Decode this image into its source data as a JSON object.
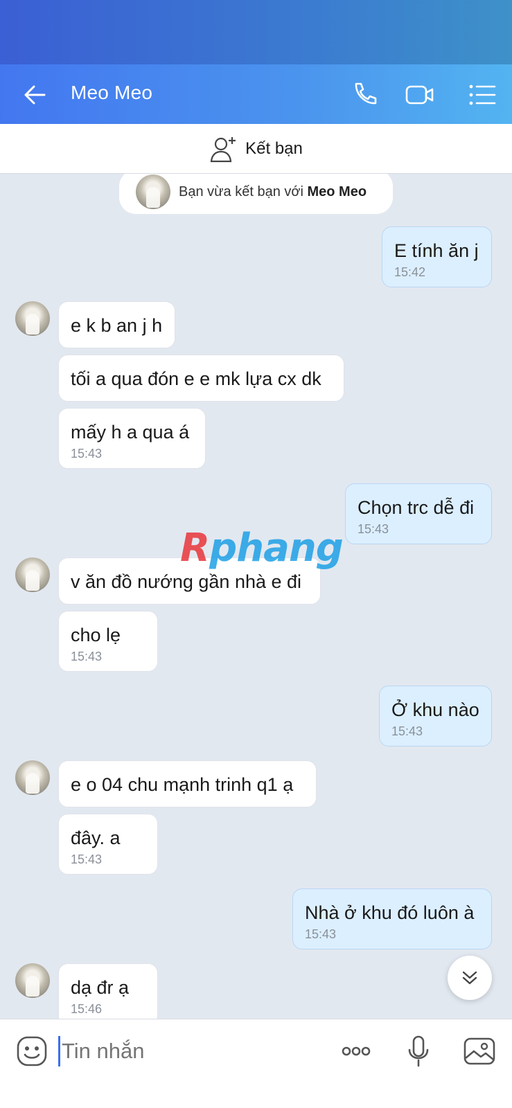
{
  "header": {
    "title": "Meo Meo",
    "icons": [
      "back-arrow-icon",
      "phone-icon",
      "video-call-icon",
      "menu-list-icon"
    ]
  },
  "add_friend": {
    "label": "Kết bạn",
    "icon": "add-user-icon"
  },
  "system_notice": {
    "prefix": "Bạn vừa kết bạn với ",
    "name": "Meo Meo"
  },
  "messages": [
    {
      "from": "me",
      "text": "E tính ăn j",
      "time": "15:42"
    },
    {
      "from": "them",
      "text": "e k b an j h",
      "time": ""
    },
    {
      "from": "them",
      "text": "tối a qua đón e e mk lựa cx dk",
      "time": ""
    },
    {
      "from": "them",
      "text": "mấy h a qua á",
      "time": "15:43"
    },
    {
      "from": "me",
      "text": "Chọn trc dễ đi",
      "time": "15:43"
    },
    {
      "from": "them",
      "text": "v ăn đồ nướng gần nhà e đi",
      "time": ""
    },
    {
      "from": "them",
      "text": "cho lẹ",
      "time": "15:43"
    },
    {
      "from": "me",
      "text": "Ở khu nào",
      "time": "15:43"
    },
    {
      "from": "them",
      "text": "e o 04 chu mạnh trinh q1 ạ",
      "time": ""
    },
    {
      "from": "them",
      "text": "đây. a",
      "time": "15:43"
    },
    {
      "from": "me",
      "text": "Nhà ở khu đó luôn à",
      "time": "15:43"
    },
    {
      "from": "them",
      "text": "dạ đr ạ",
      "time": "15:46"
    }
  ],
  "watermark": {
    "first": "R",
    "rest": "phang"
  },
  "composer": {
    "placeholder": "Tin nhắn",
    "icons": [
      "emoji-sticker-icon",
      "more-options-icon",
      "microphone-icon",
      "image-gallery-icon"
    ]
  },
  "colors": {
    "header_start": "#4377f0",
    "header_end": "#53b4f1",
    "outgoing_bubble": "#dcefff",
    "incoming_bubble": "#ffffff",
    "chat_background": "#e2e8f0"
  }
}
